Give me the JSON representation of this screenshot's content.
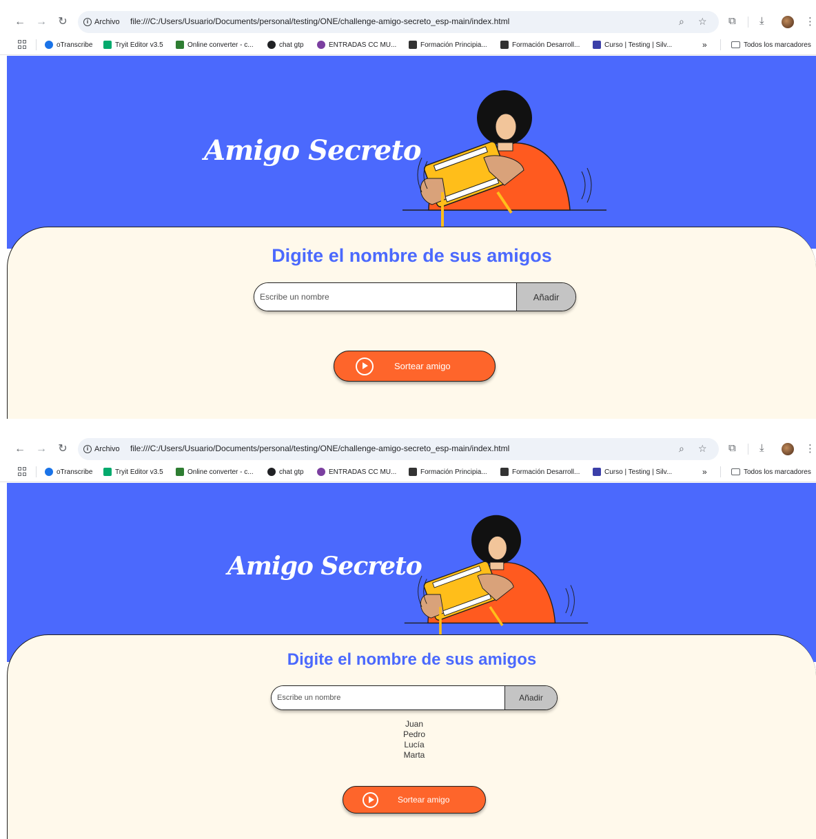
{
  "browser": {
    "site_info": "Archivo",
    "url": "file:///C:/Users/Usuario/Documents/personal/testing/ONE/challenge-amigo-secreto_esp-main/index.html",
    "bookmarks": [
      {
        "label": "oTranscribe",
        "color": "#1a73e8"
      },
      {
        "label": "Tryit Editor v3.5",
        "color": "#04aa6d"
      },
      {
        "label": "Online converter - c...",
        "color": "#2e7d32"
      },
      {
        "label": "chat gtp",
        "color": "#202124"
      },
      {
        "label": "ENTRADAS CC MU...",
        "color": "#7b3fa0"
      },
      {
        "label": "Formación Principia...",
        "color": "#333333"
      },
      {
        "label": "Formación Desarroll...",
        "color": "#333333"
      },
      {
        "label": "Curso | Testing | Silv...",
        "color": "#3b3fa8"
      }
    ],
    "overflow": "»",
    "all_bookmarks": "Todos los marcadores"
  },
  "page": {
    "title": "Amigo Secreto",
    "heading": "Digite el nombre de sus amigos",
    "input_placeholder": "Escribe un nombre",
    "add_button": "Añadir",
    "draw_button": "Sortear amigo",
    "friends": [
      "Juan",
      "Pedro",
      "Lucía",
      "Marta"
    ]
  },
  "colors": {
    "primary_blue": "#4b69fd",
    "cream": "#fff9eb",
    "orange": "#fe652b",
    "button_gray": "#c4c4c4"
  }
}
